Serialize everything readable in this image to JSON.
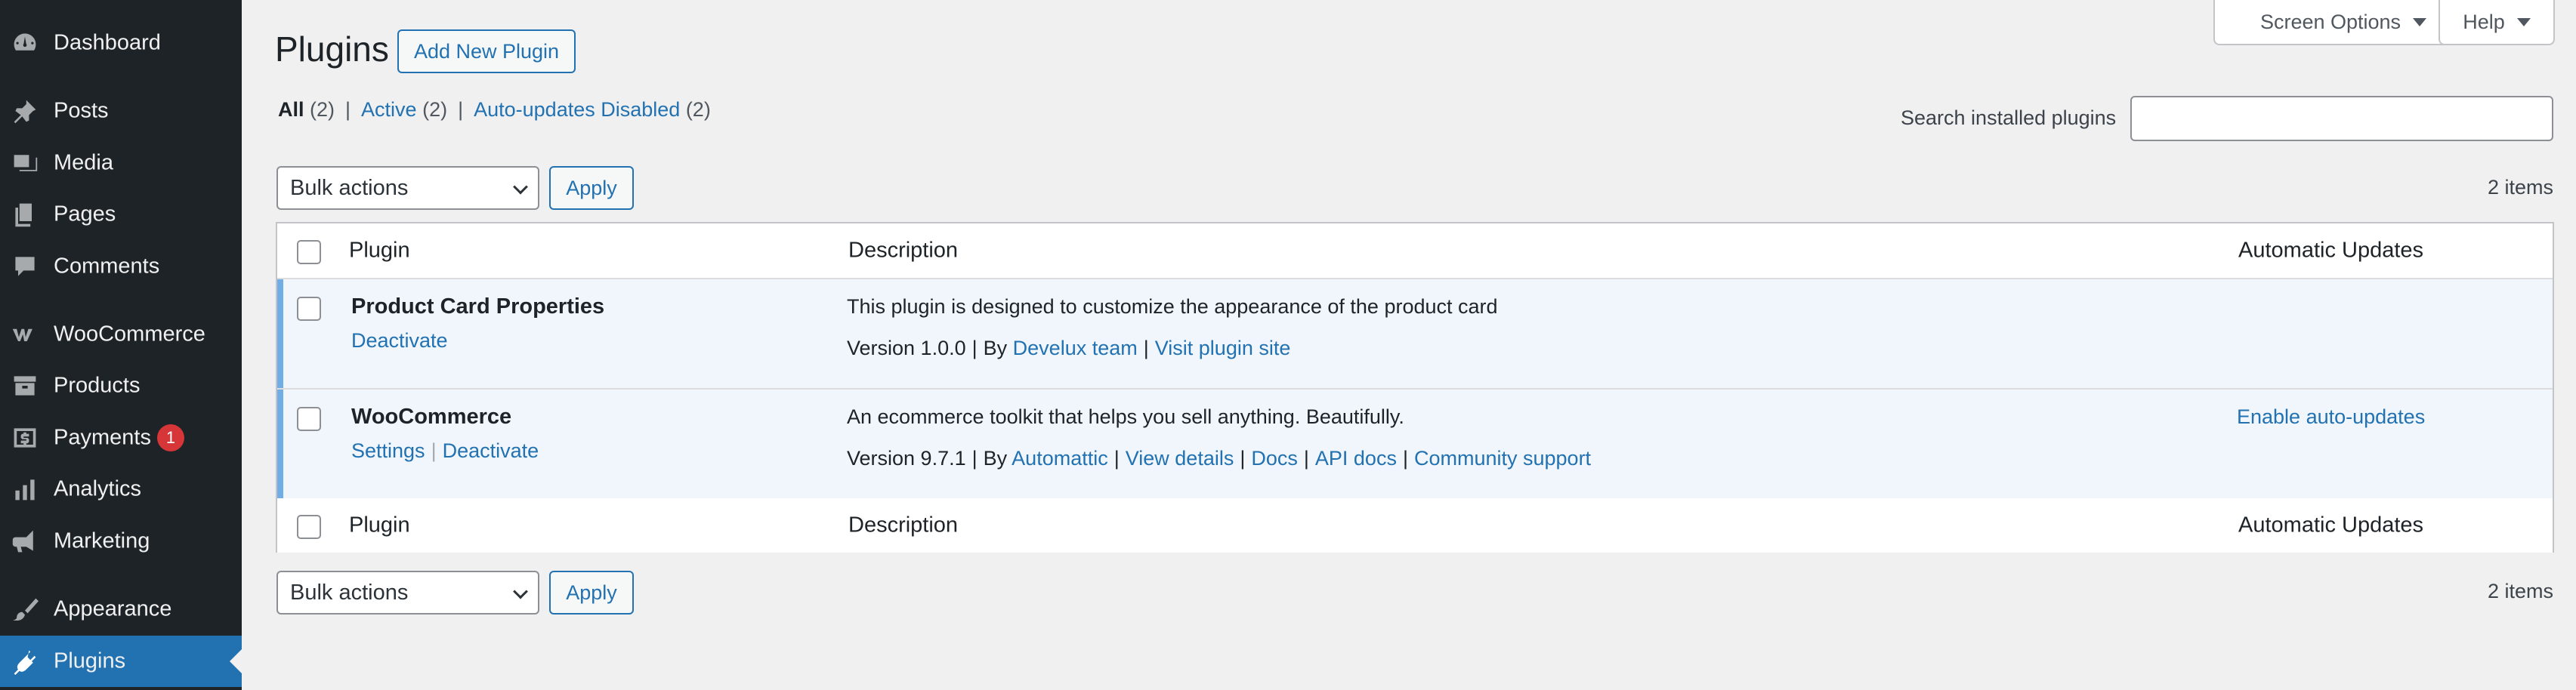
{
  "sidebar": {
    "items": [
      {
        "label": "Dashboard",
        "icon": "dashboard-icon"
      },
      {
        "label": "Posts",
        "icon": "pin-icon"
      },
      {
        "label": "Media",
        "icon": "media-icon"
      },
      {
        "label": "Pages",
        "icon": "pages-icon"
      },
      {
        "label": "Comments",
        "icon": "comment-icon"
      },
      {
        "label": "WooCommerce",
        "icon": "woocommerce-icon"
      },
      {
        "label": "Products",
        "icon": "archive-icon"
      },
      {
        "label": "Payments",
        "icon": "payments-icon",
        "badge": "1"
      },
      {
        "label": "Analytics",
        "icon": "bar-chart-icon"
      },
      {
        "label": "Marketing",
        "icon": "megaphone-icon"
      },
      {
        "label": "Appearance",
        "icon": "paintbrush-icon"
      },
      {
        "label": "Plugins",
        "icon": "plugin-icon",
        "current": true
      }
    ]
  },
  "screen_meta": {
    "screen_options": "Screen Options",
    "help": "Help"
  },
  "header": {
    "title": "Plugins",
    "add_new": "Add New Plugin"
  },
  "filters": {
    "all_label": "All",
    "all_count": "(2)",
    "active_label": "Active",
    "active_count": "(2)",
    "auto_label": "Auto-updates Disabled",
    "auto_count": "(2)",
    "separator": "|"
  },
  "search": {
    "label": "Search installed plugins",
    "value": "",
    "placeholder": ""
  },
  "bulk": {
    "select_value": "Bulk actions",
    "apply": "Apply",
    "count": "2 items"
  },
  "table": {
    "columns": [
      "Plugin",
      "Description",
      "Automatic Updates"
    ],
    "rows": [
      {
        "name": "Product Card Properties",
        "actions": [
          "Deactivate"
        ],
        "description": "This plugin is designed to customize the appearance of the product card",
        "version": "Version 1.0.0",
        "by": "By",
        "author": "Develux team",
        "links": [
          "Visit plugin site"
        ],
        "auto_update": ""
      },
      {
        "name": "WooCommerce",
        "actions": [
          "Settings",
          "Deactivate"
        ],
        "description": "An ecommerce toolkit that helps you sell anything. Beautifully.",
        "version": "Version 9.7.1",
        "by": "By",
        "author": "Automattic",
        "links": [
          "View details",
          "Docs",
          "API docs",
          "Community support"
        ],
        "auto_update": "Enable auto-updates"
      }
    ]
  },
  "colors": {
    "sidebar_bg": "#1d2327",
    "accent": "#2271b1",
    "active_row_bg": "#f0f6fc",
    "active_row_border": "#72aee6",
    "badge": "#d63638"
  }
}
